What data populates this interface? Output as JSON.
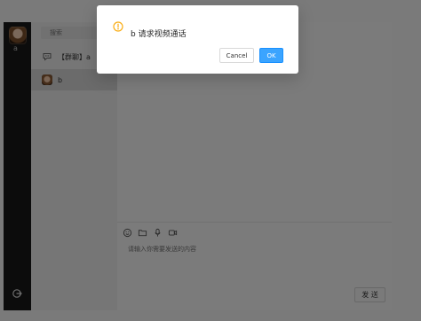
{
  "rail": {
    "username": "a",
    "logout_icon": "logout-icon"
  },
  "sidebar": {
    "search_placeholder": "搜索",
    "conversations": [
      {
        "label": "【群聊】a",
        "type": "group"
      },
      {
        "label": "b",
        "type": "user"
      }
    ]
  },
  "chat": {
    "input_placeholder": "请输入你需要发送的内容",
    "send_label": "发 送",
    "tools": [
      "emoji-icon",
      "folder-icon",
      "microphone-icon",
      "video-camera-icon"
    ]
  },
  "modal": {
    "title": "b 请求视频通话",
    "cancel_label": "Cancel",
    "ok_label": "OK",
    "icon": "warning-icon",
    "accent": "#1890ff",
    "warning_color": "#faad14"
  }
}
